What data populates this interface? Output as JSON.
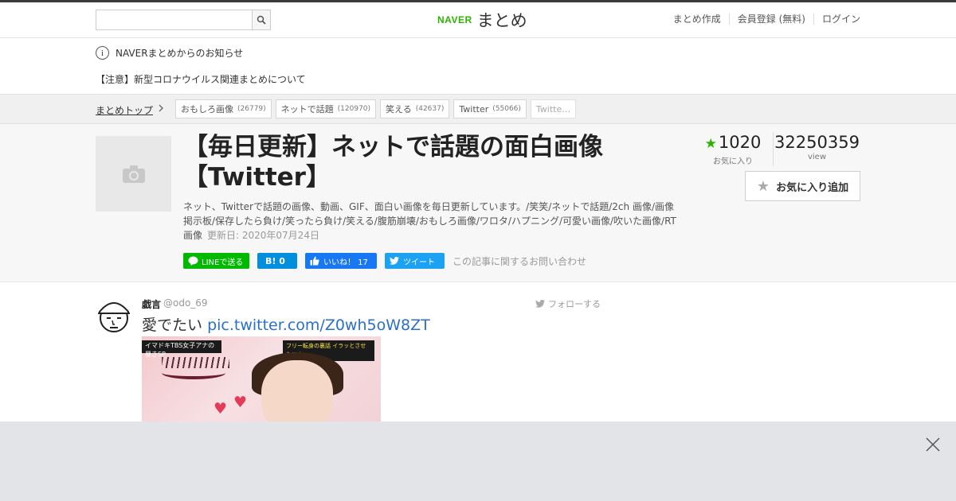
{
  "header": {
    "search_placeholder": "",
    "logo_naver": "NAVER",
    "logo_matome": "まとめ",
    "nav": [
      "まとめ作成",
      "会員登録 (無料)",
      "ログイン"
    ]
  },
  "notice": {
    "title": "NAVERまとめからのお知らせ",
    "item": "【注意】新型コロナウイルス関連まとめについて"
  },
  "categories": {
    "top_label": "まとめトップ",
    "tags": [
      {
        "label": "おもしろ画像",
        "count": "(26779)"
      },
      {
        "label": "ネットで話題",
        "count": "(120970)"
      },
      {
        "label": "笑える",
        "count": "(42637)"
      },
      {
        "label": "Twitter",
        "count": "(55066)"
      },
      {
        "label": "Twitte…",
        "count": ""
      }
    ]
  },
  "article": {
    "title": "【毎日更新】ネットで話題の面白画像【Twitter】",
    "description": "ネット、Twitterで話題の画像、動画、GIF、面白い画像を毎日更新しています。/笑笑/ネットで話題/2ch 画像/画像掲示板/保存したら負け/笑ったら負け/笑える/腹筋崩壊/おもしろ画像/ワロタ/ハプニング/可愛い画像/吹いた画像/RT画像",
    "updated": "更新日: 2020年07月24日",
    "favorites_count": "1020",
    "favorites_label": "お気に入り",
    "views_count": "32250359",
    "views_label": "view",
    "fav_button": "お気に入り追加",
    "share": {
      "line": "LINEで送る",
      "hatena": "B! 0",
      "facebook": "いいね！ 17",
      "twitter": "ツイート",
      "inquiry": "この記事に関するお問い合わせ"
    }
  },
  "tweet": {
    "name": "戯言",
    "handle": "@odo_69",
    "follow": "フォローする",
    "text": "愛でたい",
    "link": "pic.twitter.com/Z0wh5oW8ZT",
    "image_banner_left": "イマドキTBS女子アナの暴きSP",
    "image_banner_right": "フリー転身の裏話 イラッとさせたアナ"
  },
  "colors": {
    "brand_green": "#2db400",
    "link_blue": "#2a6fcc",
    "line_green": "#00b900",
    "hatena_blue": "#008fde",
    "facebook_blue": "#1877f2",
    "twitter_blue": "#1da1f2"
  },
  "icons": [
    "search-icon",
    "info-icon",
    "chevron-right-icon",
    "camera-icon",
    "star-icon",
    "twitter-bird-icon",
    "close-icon"
  ]
}
